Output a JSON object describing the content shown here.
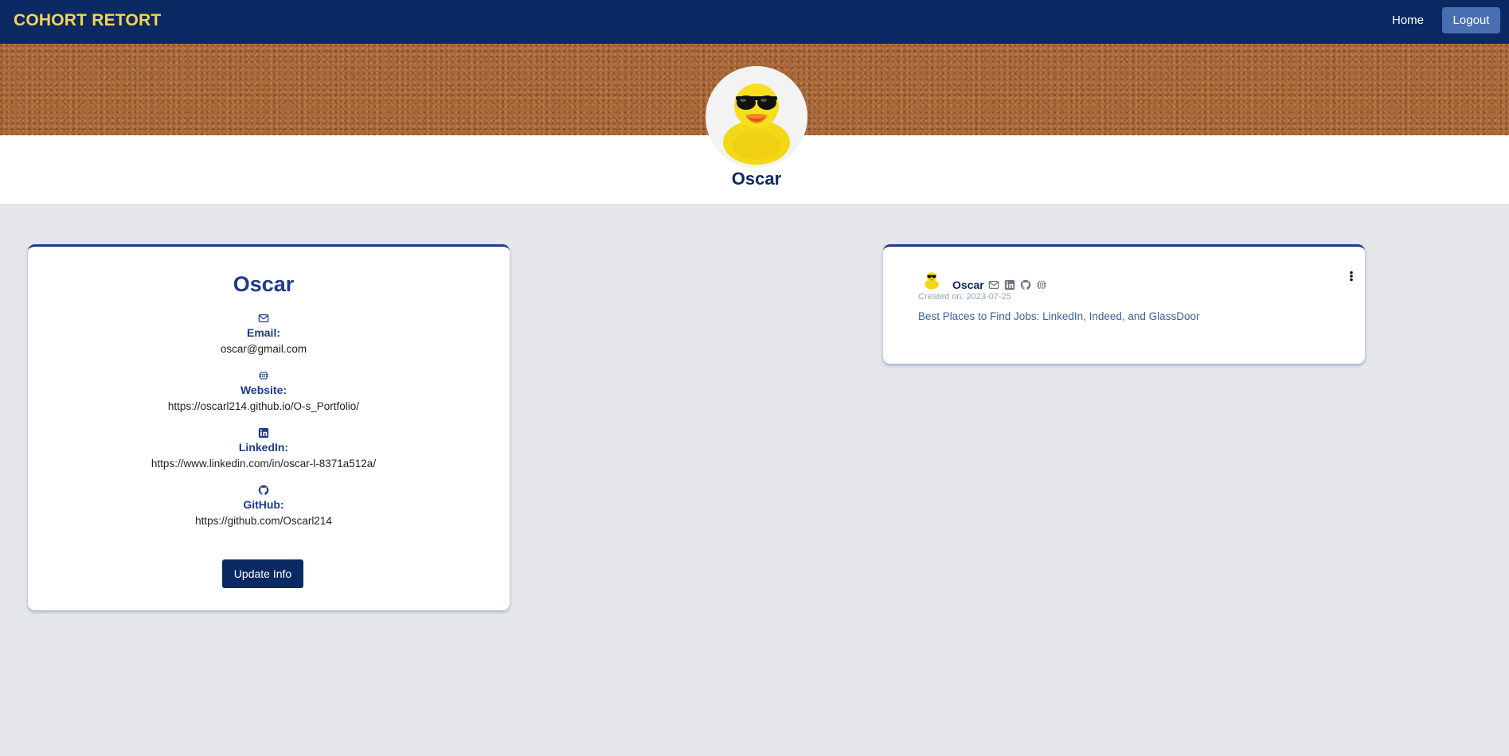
{
  "navbar": {
    "brand": "COHORT RETORT",
    "home_label": "Home",
    "logout_label": "Logout",
    "colors": {
      "bg": "#0b2a63",
      "brand": "#f5d35a",
      "logout_bg": "#4a6fb0"
    }
  },
  "profile": {
    "name": "Oscar",
    "avatar_icon": "rubber-duck-sunglasses"
  },
  "info_card": {
    "title": "Oscar",
    "fields": [
      {
        "icon": "envelope-icon",
        "label": "Email:",
        "value": "oscar@gmail.com"
      },
      {
        "icon": "globe-icon",
        "label": "Website:",
        "value": "https://oscarl214.github.io/O-s_Portfolio/"
      },
      {
        "icon": "linkedin-icon",
        "label": "LinkedIn:",
        "value": "https://www.linkedin.com/in/oscar-l-8371a512a/"
      },
      {
        "icon": "github-icon",
        "label": "GitHub:",
        "value": "https://github.com/Oscarl214"
      }
    ],
    "update_button": "Update Info"
  },
  "post": {
    "author": "Oscar",
    "icons": [
      "envelope-icon",
      "linkedin-icon",
      "github-icon",
      "globe-icon"
    ],
    "created": "Created on: 2023-07-25",
    "text": "Best Places to Find Jobs: LinkedIn, Indeed, and GlassDoor",
    "menu_icon": "kebab-menu-icon"
  }
}
